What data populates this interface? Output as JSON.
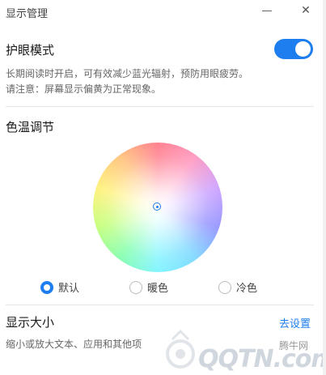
{
  "window": {
    "title": "显示管理",
    "minimize_glyph": "—",
    "close_glyph": "✕"
  },
  "eye_care": {
    "title": "护眼模式",
    "toggle_on": true,
    "desc_line1": "长期阅读时开启，可有效减少蓝光辐射，预防用眼疲劳。",
    "desc_line2": "请注意：屏幕显示偏黄为正常现象。"
  },
  "color_temp": {
    "title": "色温调节",
    "options": [
      {
        "label": "默认",
        "selected": true
      },
      {
        "label": "暖色",
        "selected": false
      },
      {
        "label": "冷色",
        "selected": false
      }
    ]
  },
  "display_size": {
    "title": "显示大小",
    "link": "去设置",
    "desc": "缩小或放大文本、应用和其他项"
  },
  "watermark": {
    "brand": "QQTN.com",
    "small": "腾牛网"
  },
  "colors": {
    "accent": "#1e7ef0"
  },
  "icons": [
    "minimize-icon",
    "close-icon",
    "wheel-center-icon"
  ]
}
